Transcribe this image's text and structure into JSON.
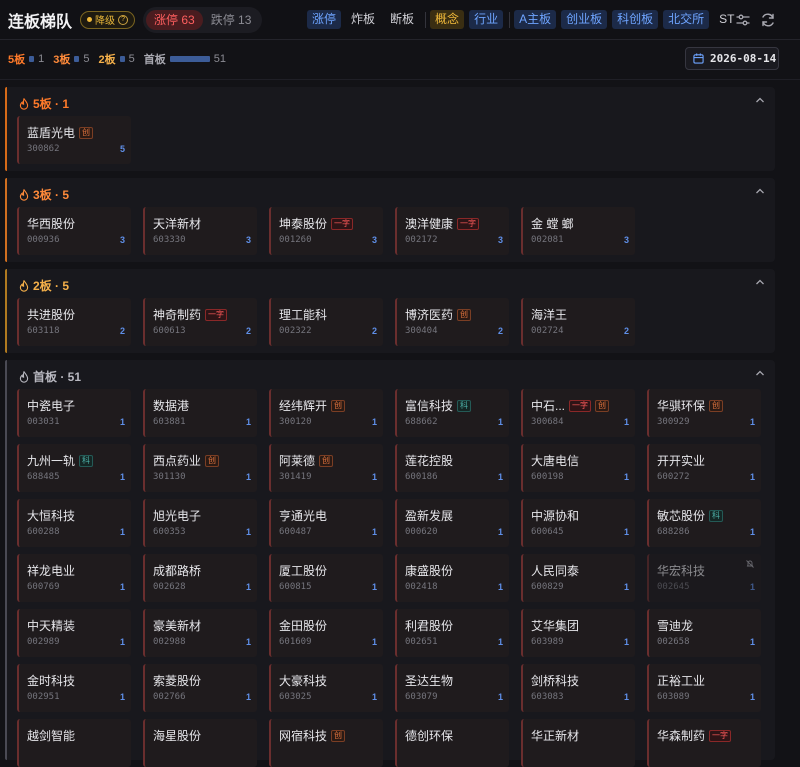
{
  "header": {
    "title": "连板梯队",
    "badge_down": "降级",
    "limit_up": "涨停 63",
    "limit_down": "跌停 13"
  },
  "filters": {
    "kind": [
      "涨停",
      "炸板",
      "断板"
    ],
    "group": [
      "概念",
      "行业"
    ],
    "board": [
      "A主板",
      "创业板",
      "科创板",
      "北交所",
      "ST"
    ]
  },
  "stats": [
    {
      "label": "5板",
      "count": "1",
      "color": "#ff7a2a"
    },
    {
      "label": "3板",
      "count": "5",
      "color": "#ff8a3a"
    },
    {
      "label": "2板",
      "count": "5",
      "color": "#f5b04a"
    },
    {
      "label": "首板",
      "count": "51",
      "color": "#a8a8b0"
    }
  ],
  "date": "2026-08-14",
  "tags": {
    "chuang": "创",
    "ke": "科",
    "yizi": "一字"
  },
  "sections": [
    {
      "title": "5板 · 1",
      "color": "#ff7a2a",
      "accent": "#d66a18",
      "stocks": [
        {
          "name": "蓝盾光电",
          "code": "300862",
          "lvl": "5",
          "tags": [
            "chuang"
          ]
        }
      ]
    },
    {
      "title": "3板 · 5",
      "color": "#ff8a3a",
      "accent": "#d06f20",
      "stocks": [
        {
          "name": "华西股份",
          "code": "000936",
          "lvl": "3",
          "tags": []
        },
        {
          "name": "天洋新材",
          "code": "603330",
          "lvl": "3",
          "tags": []
        },
        {
          "name": "坤泰股份",
          "code": "001260",
          "lvl": "3",
          "tags": [
            "yizi"
          ]
        },
        {
          "name": "澳洋健康",
          "code": "002172",
          "lvl": "3",
          "tags": [
            "yizi"
          ]
        },
        {
          "name": "金 螳 螂",
          "code": "002081",
          "lvl": "3",
          "tags": []
        }
      ]
    },
    {
      "title": "2板 · 5",
      "color": "#f5b04a",
      "accent": "#b07a20",
      "stocks": [
        {
          "name": "共进股份",
          "code": "603118",
          "lvl": "2",
          "tags": []
        },
        {
          "name": "神奇制药",
          "code": "600613",
          "lvl": "2",
          "tags": [
            "yizi"
          ]
        },
        {
          "name": "理工能科",
          "code": "002322",
          "lvl": "2",
          "tags": []
        },
        {
          "name": "博济医药",
          "code": "300404",
          "lvl": "2",
          "tags": [
            "chuang"
          ]
        },
        {
          "name": "海洋王",
          "code": "002724",
          "lvl": "2",
          "tags": []
        }
      ]
    },
    {
      "title": "首板 · 51",
      "color": "#b8b8c0",
      "accent": "#4a4a54",
      "stocks": [
        {
          "name": "中瓷电子",
          "code": "003031",
          "lvl": "1",
          "tags": []
        },
        {
          "name": "数据港",
          "code": "603881",
          "lvl": "1",
          "tags": []
        },
        {
          "name": "经纬辉开",
          "code": "300120",
          "lvl": "1",
          "tags": [
            "chuang"
          ]
        },
        {
          "name": "富信科技",
          "code": "688662",
          "lvl": "1",
          "tags": [
            "ke"
          ]
        },
        {
          "name": "中石...",
          "code": "300684",
          "lvl": "1",
          "tags": [
            "yizi",
            "chuang"
          ]
        },
        {
          "name": "华骐环保",
          "code": "300929",
          "lvl": "1",
          "tags": [
            "chuang"
          ]
        },
        {
          "name": "九州一轨",
          "code": "688485",
          "lvl": "1",
          "tags": [
            "ke"
          ]
        },
        {
          "name": "西点药业",
          "code": "301130",
          "lvl": "1",
          "tags": [
            "chuang"
          ]
        },
        {
          "name": "阿莱德",
          "code": "301419",
          "lvl": "1",
          "tags": [
            "chuang"
          ]
        },
        {
          "name": "莲花控股",
          "code": "600186",
          "lvl": "1",
          "tags": []
        },
        {
          "name": "大唐电信",
          "code": "600198",
          "lvl": "1",
          "tags": []
        },
        {
          "name": "开开实业",
          "code": "600272",
          "lvl": "1",
          "tags": []
        },
        {
          "name": "大恒科技",
          "code": "600288",
          "lvl": "1",
          "tags": []
        },
        {
          "name": "旭光电子",
          "code": "600353",
          "lvl": "1",
          "tags": []
        },
        {
          "name": "亨通光电",
          "code": "600487",
          "lvl": "1",
          "tags": []
        },
        {
          "name": "盈新发展",
          "code": "000620",
          "lvl": "1",
          "tags": []
        },
        {
          "name": "中源协和",
          "code": "600645",
          "lvl": "1",
          "tags": []
        },
        {
          "name": "敏芯股份",
          "code": "688286",
          "lvl": "1",
          "tags": [
            "ke"
          ]
        },
        {
          "name": "祥龙电业",
          "code": "600769",
          "lvl": "1",
          "tags": []
        },
        {
          "name": "成都路桥",
          "code": "002628",
          "lvl": "1",
          "tags": []
        },
        {
          "name": "厦工股份",
          "code": "600815",
          "lvl": "1",
          "tags": []
        },
        {
          "name": "康盛股份",
          "code": "002418",
          "lvl": "1",
          "tags": []
        },
        {
          "name": "人民同泰",
          "code": "600829",
          "lvl": "1",
          "tags": []
        },
        {
          "name": "华宏科技",
          "code": "002645",
          "lvl": "1",
          "tags": [],
          "muted": true
        },
        {
          "name": "中天精装",
          "code": "002989",
          "lvl": "1",
          "tags": []
        },
        {
          "name": "豪美新材",
          "code": "002988",
          "lvl": "1",
          "tags": []
        },
        {
          "name": "金田股份",
          "code": "601609",
          "lvl": "1",
          "tags": []
        },
        {
          "name": "利君股份",
          "code": "002651",
          "lvl": "1",
          "tags": []
        },
        {
          "name": "艾华集团",
          "code": "603989",
          "lvl": "1",
          "tags": []
        },
        {
          "name": "雪迪龙",
          "code": "002658",
          "lvl": "1",
          "tags": []
        },
        {
          "name": "金时科技",
          "code": "002951",
          "lvl": "1",
          "tags": []
        },
        {
          "name": "索菱股份",
          "code": "002766",
          "lvl": "1",
          "tags": []
        },
        {
          "name": "大豪科技",
          "code": "603025",
          "lvl": "1",
          "tags": []
        },
        {
          "name": "圣达生物",
          "code": "603079",
          "lvl": "1",
          "tags": []
        },
        {
          "name": "剑桥科技",
          "code": "603083",
          "lvl": "1",
          "tags": []
        },
        {
          "name": "正裕工业",
          "code": "603089",
          "lvl": "1",
          "tags": []
        },
        {
          "name": "越剑智能",
          "code": "",
          "lvl": "",
          "tags": []
        },
        {
          "name": "海星股份",
          "code": "",
          "lvl": "",
          "tags": []
        },
        {
          "name": "网宿科技",
          "code": "",
          "lvl": "",
          "tags": [
            "chuang"
          ]
        },
        {
          "name": "德创环保",
          "code": "",
          "lvl": "",
          "tags": []
        },
        {
          "name": "华正新材",
          "code": "",
          "lvl": "",
          "tags": []
        },
        {
          "name": "华森制药",
          "code": "",
          "lvl": "",
          "tags": [
            "yizi"
          ]
        }
      ]
    }
  ]
}
